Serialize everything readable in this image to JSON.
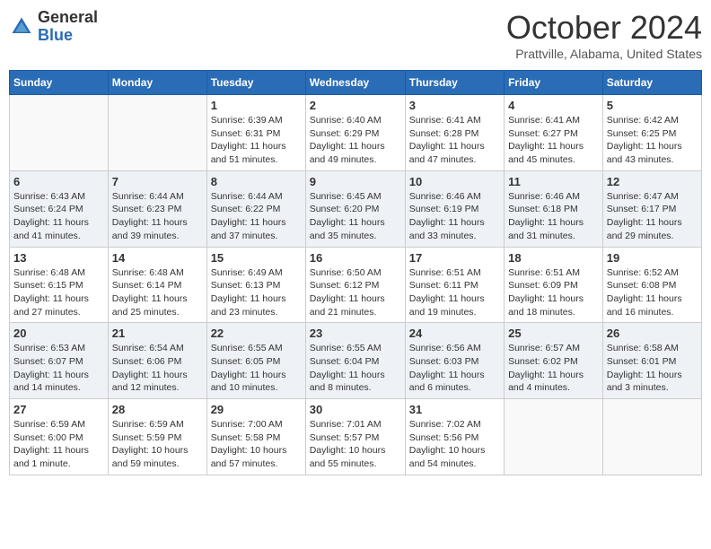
{
  "header": {
    "logo_general": "General",
    "logo_blue": "Blue",
    "month_title": "October 2024",
    "location": "Prattville, Alabama, United States"
  },
  "days_of_week": [
    "Sunday",
    "Monday",
    "Tuesday",
    "Wednesday",
    "Thursday",
    "Friday",
    "Saturday"
  ],
  "weeks": [
    [
      {
        "day": "",
        "info": ""
      },
      {
        "day": "",
        "info": ""
      },
      {
        "day": "1",
        "info": "Sunrise: 6:39 AM\nSunset: 6:31 PM\nDaylight: 11 hours and 51 minutes."
      },
      {
        "day": "2",
        "info": "Sunrise: 6:40 AM\nSunset: 6:29 PM\nDaylight: 11 hours and 49 minutes."
      },
      {
        "day": "3",
        "info": "Sunrise: 6:41 AM\nSunset: 6:28 PM\nDaylight: 11 hours and 47 minutes."
      },
      {
        "day": "4",
        "info": "Sunrise: 6:41 AM\nSunset: 6:27 PM\nDaylight: 11 hours and 45 minutes."
      },
      {
        "day": "5",
        "info": "Sunrise: 6:42 AM\nSunset: 6:25 PM\nDaylight: 11 hours and 43 minutes."
      }
    ],
    [
      {
        "day": "6",
        "info": "Sunrise: 6:43 AM\nSunset: 6:24 PM\nDaylight: 11 hours and 41 minutes."
      },
      {
        "day": "7",
        "info": "Sunrise: 6:44 AM\nSunset: 6:23 PM\nDaylight: 11 hours and 39 minutes."
      },
      {
        "day": "8",
        "info": "Sunrise: 6:44 AM\nSunset: 6:22 PM\nDaylight: 11 hours and 37 minutes."
      },
      {
        "day": "9",
        "info": "Sunrise: 6:45 AM\nSunset: 6:20 PM\nDaylight: 11 hours and 35 minutes."
      },
      {
        "day": "10",
        "info": "Sunrise: 6:46 AM\nSunset: 6:19 PM\nDaylight: 11 hours and 33 minutes."
      },
      {
        "day": "11",
        "info": "Sunrise: 6:46 AM\nSunset: 6:18 PM\nDaylight: 11 hours and 31 minutes."
      },
      {
        "day": "12",
        "info": "Sunrise: 6:47 AM\nSunset: 6:17 PM\nDaylight: 11 hours and 29 minutes."
      }
    ],
    [
      {
        "day": "13",
        "info": "Sunrise: 6:48 AM\nSunset: 6:15 PM\nDaylight: 11 hours and 27 minutes."
      },
      {
        "day": "14",
        "info": "Sunrise: 6:48 AM\nSunset: 6:14 PM\nDaylight: 11 hours and 25 minutes."
      },
      {
        "day": "15",
        "info": "Sunrise: 6:49 AM\nSunset: 6:13 PM\nDaylight: 11 hours and 23 minutes."
      },
      {
        "day": "16",
        "info": "Sunrise: 6:50 AM\nSunset: 6:12 PM\nDaylight: 11 hours and 21 minutes."
      },
      {
        "day": "17",
        "info": "Sunrise: 6:51 AM\nSunset: 6:11 PM\nDaylight: 11 hours and 19 minutes."
      },
      {
        "day": "18",
        "info": "Sunrise: 6:51 AM\nSunset: 6:09 PM\nDaylight: 11 hours and 18 minutes."
      },
      {
        "day": "19",
        "info": "Sunrise: 6:52 AM\nSunset: 6:08 PM\nDaylight: 11 hours and 16 minutes."
      }
    ],
    [
      {
        "day": "20",
        "info": "Sunrise: 6:53 AM\nSunset: 6:07 PM\nDaylight: 11 hours and 14 minutes."
      },
      {
        "day": "21",
        "info": "Sunrise: 6:54 AM\nSunset: 6:06 PM\nDaylight: 11 hours and 12 minutes."
      },
      {
        "day": "22",
        "info": "Sunrise: 6:55 AM\nSunset: 6:05 PM\nDaylight: 11 hours and 10 minutes."
      },
      {
        "day": "23",
        "info": "Sunrise: 6:55 AM\nSunset: 6:04 PM\nDaylight: 11 hours and 8 minutes."
      },
      {
        "day": "24",
        "info": "Sunrise: 6:56 AM\nSunset: 6:03 PM\nDaylight: 11 hours and 6 minutes."
      },
      {
        "day": "25",
        "info": "Sunrise: 6:57 AM\nSunset: 6:02 PM\nDaylight: 11 hours and 4 minutes."
      },
      {
        "day": "26",
        "info": "Sunrise: 6:58 AM\nSunset: 6:01 PM\nDaylight: 11 hours and 3 minutes."
      }
    ],
    [
      {
        "day": "27",
        "info": "Sunrise: 6:59 AM\nSunset: 6:00 PM\nDaylight: 11 hours and 1 minute."
      },
      {
        "day": "28",
        "info": "Sunrise: 6:59 AM\nSunset: 5:59 PM\nDaylight: 10 hours and 59 minutes."
      },
      {
        "day": "29",
        "info": "Sunrise: 7:00 AM\nSunset: 5:58 PM\nDaylight: 10 hours and 57 minutes."
      },
      {
        "day": "30",
        "info": "Sunrise: 7:01 AM\nSunset: 5:57 PM\nDaylight: 10 hours and 55 minutes."
      },
      {
        "day": "31",
        "info": "Sunrise: 7:02 AM\nSunset: 5:56 PM\nDaylight: 10 hours and 54 minutes."
      },
      {
        "day": "",
        "info": ""
      },
      {
        "day": "",
        "info": ""
      }
    ]
  ]
}
